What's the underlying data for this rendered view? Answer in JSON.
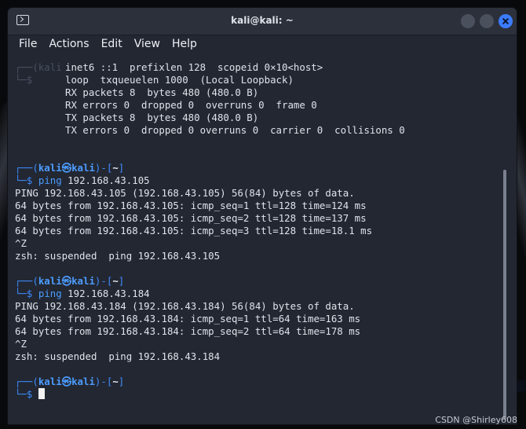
{
  "window": {
    "title": "kali@kali: ~"
  },
  "menu": {
    "file": "File",
    "actions": "Actions",
    "edit": "Edit",
    "view": "View",
    "help": "Help"
  },
  "terminal": {
    "ghost_prompt_1": "┌──(kali",
    "ghost_prompt_2": "└─$",
    "ifconfig_lines": [
      "inet6 ::1  prefixlen 128  scopeid 0×10<host>",
      "loop  txqueuelen 1000  (Local Loopback)",
      "RX packets 8  bytes 480 (480.0 B)",
      "RX errors 0  dropped 0  overruns 0  frame 0",
      "TX packets 8  bytes 480 (480.0 B)",
      "TX errors 0  dropped 0 overruns 0  carrier 0  collisions 0"
    ],
    "prompt": {
      "open": "┌──(",
      "user": "kali",
      "skull": "㉿",
      "host": "kali",
      "mid": ")-[",
      "dir": "~",
      "close": "]",
      "arrow": "└─$"
    },
    "block1": {
      "command": "ping",
      "arg": "192.168.43.105",
      "output": [
        "PING 192.168.43.105 (192.168.43.105) 56(84) bytes of data.",
        "64 bytes from 192.168.43.105: icmp_seq=1 ttl=128 time=124 ms",
        "64 bytes from 192.168.43.105: icmp_seq=2 ttl=128 time=137 ms",
        "64 bytes from 192.168.43.105: icmp_seq=3 ttl=128 time=18.1 ms",
        "^Z",
        "zsh: suspended  ping 192.168.43.105"
      ]
    },
    "block2": {
      "command": "ping",
      "arg": "192.168.43.184",
      "output": [
        "PING 192.168.43.184 (192.168.43.184) 56(84) bytes of data.",
        "64 bytes from 192.168.43.184: icmp_seq=1 ttl=64 time=163 ms",
        "64 bytes from 192.168.43.184: icmp_seq=2 ttl=64 time=178 ms",
        "^Z",
        "zsh: suspended  ping 192.168.43.184"
      ]
    }
  },
  "watermark": "CSDN @Shirley608",
  "icons": {
    "terminal": "terminal-icon",
    "minimize": "minimize-icon",
    "maximize": "maximize-icon",
    "close": "close-icon"
  },
  "colors": {
    "terminal_bg": "#222732",
    "prompt_blue": "#3e8cff",
    "close_button": "#3b7cff"
  }
}
